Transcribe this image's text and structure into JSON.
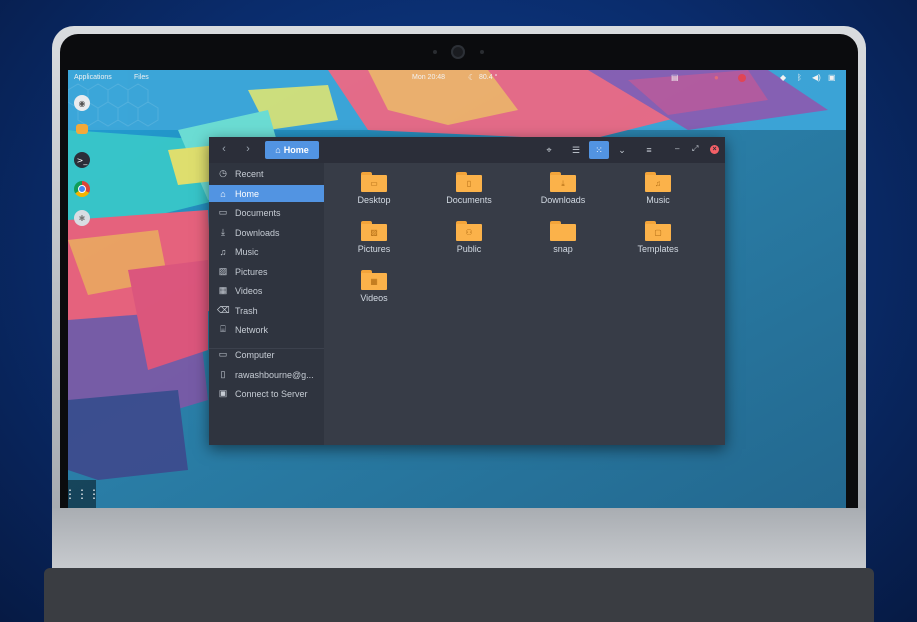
{
  "topbar": {
    "applications": "Applications",
    "files": "Files",
    "clock": "Mon 20:48",
    "weather": "80.4 °",
    "icons": [
      "clipboard-icon",
      "record-icon",
      "wifi-icon",
      "bluetooth-icon",
      "volume-icon",
      "battery-icon"
    ]
  },
  "dock": {
    "items": [
      "screenshot-icon",
      "slides-icon",
      "terminal-icon",
      "chrome-icon",
      "settings-icon"
    ],
    "apps_grid": "⋮⋮⋮"
  },
  "file_manager": {
    "breadcrumb": "Home",
    "sidebar": {
      "items": [
        {
          "label": "Recent",
          "icon": "clock-icon"
        },
        {
          "label": "Home",
          "icon": "home-icon"
        },
        {
          "label": "Documents",
          "icon": "document-icon"
        },
        {
          "label": "Downloads",
          "icon": "download-icon"
        },
        {
          "label": "Music",
          "icon": "music-icon"
        },
        {
          "label": "Pictures",
          "icon": "picture-icon"
        },
        {
          "label": "Videos",
          "icon": "video-icon"
        },
        {
          "label": "Trash",
          "icon": "trash-icon"
        },
        {
          "label": "Network",
          "icon": "network-icon"
        },
        {
          "label": "Computer",
          "icon": "computer-icon"
        },
        {
          "label": "rawashbourne@g...",
          "icon": "account-icon"
        },
        {
          "label": "Connect to Server",
          "icon": "server-icon"
        }
      ],
      "active": "Home"
    },
    "folders": [
      {
        "label": "Desktop",
        "icon": "desktop-icon"
      },
      {
        "label": "Documents",
        "icon": "document-icon"
      },
      {
        "label": "Downloads",
        "icon": "download-icon"
      },
      {
        "label": "Music",
        "icon": "music-icon"
      },
      {
        "label": "Pictures",
        "icon": "picture-icon"
      },
      {
        "label": "Public",
        "icon": "people-icon"
      },
      {
        "label": "snap",
        "icon": "folder-icon"
      },
      {
        "label": "Templates",
        "icon": "template-icon"
      },
      {
        "label": "Videos",
        "icon": "video-icon"
      }
    ]
  },
  "colors": {
    "accent": "#5294e2",
    "folder": "#fbb24a",
    "window_bg": "#373c47",
    "sidebar_bg": "#2f343f",
    "header_bg": "#2b2e39"
  }
}
